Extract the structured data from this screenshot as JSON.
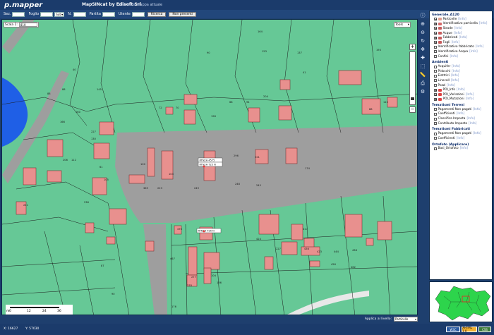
{
  "header": {
    "logo": "p.mapper",
    "title": "MapSINcat by Edisoft Srl",
    "subtitle": "Link della mappa attuale"
  },
  "searchbar": {
    "sez_label": "Sez.",
    "foglio_label": "Foglio",
    "sub_select": "Sub",
    "n_label": "N.",
    "partita_label": "Partita",
    "utente_label": "Utente",
    "search_button": "Ricerca",
    "nonpresenti_button": "Non presenti"
  },
  "map": {
    "scale_label": "Scala 1:",
    "scale_value": "810",
    "tools_select": "Tools",
    "zoom_in": "+",
    "zoom_out": "−",
    "scalebar_ticks": [
      "0",
      "12",
      "24",
      "36"
    ],
    "scalebar_unit": "m",
    "apply_label": "Applica al livello:",
    "apply_value": "Particelle",
    "parcel_numbers": [
      "164",
      "153",
      "40",
      "193",
      "90",
      "137",
      "41",
      "88",
      "88",
      "145",
      "160",
      "72",
      "70",
      "196",
      "68",
      "94",
      "88",
      "110",
      "166",
      "227",
      "130",
      "204",
      "206",
      "112",
      "61",
      "105",
      "100",
      "103",
      "267",
      "296",
      "221",
      "174",
      "369",
      "249",
      "223",
      "248",
      "245",
      "476",
      "417",
      "227",
      "424",
      "423",
      "436",
      "426",
      "444",
      "438",
      "462",
      "467",
      "277",
      "104",
      "378",
      "176",
      "186",
      "87",
      "90",
      "236",
      "241"
    ],
    "label_boxes": [
      "RTN2H 4575",
      "RTN2H T25 N",
      "RTN2H T25 N"
    ]
  },
  "toc": {
    "groups": [
      {
        "title": "Generale_A120",
        "items": [
          {
            "label": "Particelle",
            "checked": true,
            "color": "#e0a090",
            "info": "[Info]"
          },
          {
            "label": "Identificativo particella",
            "checked": true,
            "color": "#d46a6a",
            "info": "[Info]"
          },
          {
            "label": "Strade",
            "checked": true,
            "color": "#c75b5b",
            "info": "[Info]"
          },
          {
            "label": "Acque",
            "checked": true,
            "color": "#c75b5b",
            "info": "[Info]"
          },
          {
            "label": "Fabbricati",
            "checked": true,
            "color": "#c75b5b",
            "info": "[Info]"
          },
          {
            "label": "Fogli",
            "checked": true,
            "color": "#c75b5b",
            "info": "[Info]"
          },
          {
            "label": "Identificativo fabbricato",
            "checked": false,
            "color": "",
            "info": "[Info]"
          },
          {
            "label": "Identificativo Acqua",
            "checked": false,
            "color": "",
            "info": "[Info]"
          },
          {
            "label": "Confini",
            "checked": false,
            "color": "",
            "info": "[Info]"
          }
        ]
      },
      {
        "title": "Ambienti",
        "items": [
          {
            "label": "Acquifer",
            "checked": false,
            "color": "",
            "info": "[Info]"
          },
          {
            "label": "Pidocchi",
            "checked": false,
            "color": "",
            "info": "[Info]"
          },
          {
            "label": "Elettrici",
            "checked": false,
            "color": "",
            "info": "[Info]"
          },
          {
            "label": "Linecall",
            "checked": false,
            "color": "",
            "info": "[Info]"
          },
          {
            "label": "Pozzi",
            "checked": false,
            "color": "",
            "info": "[Info]"
          },
          {
            "label": "POI_Info",
            "checked": true,
            "color": "#d44",
            "info": "[Info]"
          },
          {
            "label": "POI_Variazioni",
            "checked": true,
            "color": "#d44",
            "info": "[Info]"
          },
          {
            "label": "POI_Mutazioni",
            "checked": true,
            "color": "#d44",
            "info": "[Info]"
          }
        ]
      },
      {
        "title": "Tematismi Terreni",
        "items": [
          {
            "label": "Pagamenti Non pagati",
            "checked": false,
            "color": "",
            "info": "[Info]"
          },
          {
            "label": "Coefficienti",
            "checked": false,
            "color": "",
            "info": "[Info]"
          },
          {
            "label": "Classifica Imposta",
            "checked": false,
            "color": "",
            "info": "[Info]"
          },
          {
            "label": "Contributo Imposta",
            "checked": false,
            "color": "",
            "info": "[Info]"
          }
        ]
      },
      {
        "title": "Tematismi Fabbricati",
        "items": [
          {
            "label": "Pagamenti Non pagati",
            "checked": false,
            "color": "",
            "info": "[Info]"
          },
          {
            "label": "Coefficienti",
            "checked": false,
            "color": "",
            "info": "[Info]"
          }
        ]
      },
      {
        "title": "Ortofoto (Applicare)",
        "items": [
          {
            "label": "Basi_Ortofoto",
            "checked": false,
            "color": "",
            "info": "[Info]"
          }
        ]
      }
    ]
  },
  "status": {
    "x": "X: 16627",
    "y": "Y: 57030",
    "badge1": "W3C",
    "badge2": "XHTML 1.0",
    "badge3": "CSS"
  }
}
